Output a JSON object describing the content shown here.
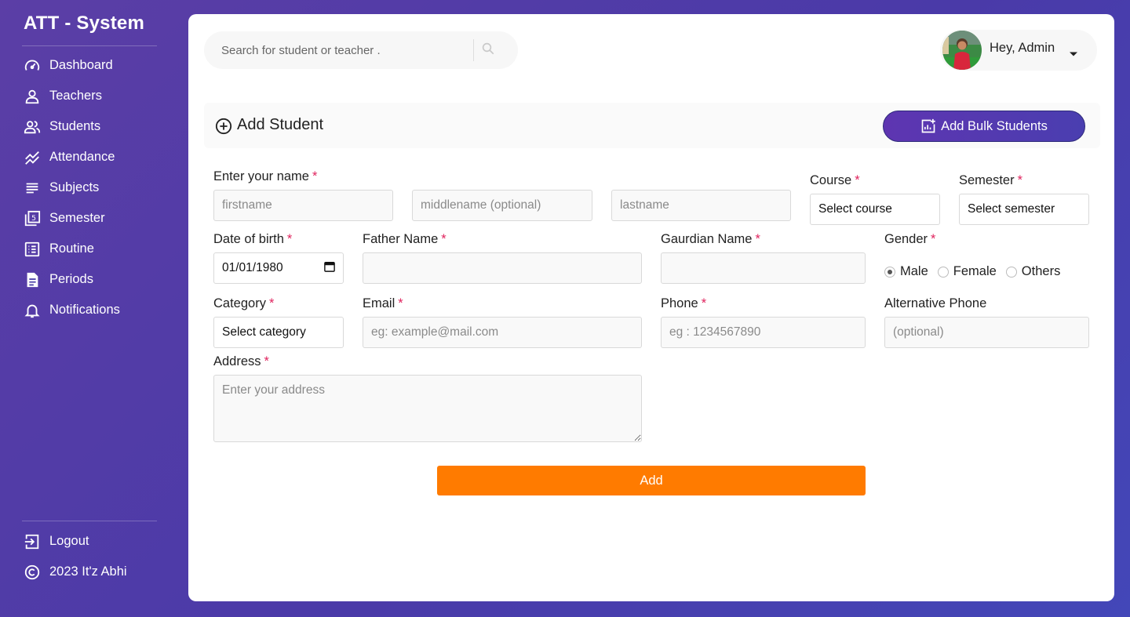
{
  "app": {
    "brand": "ATT - System"
  },
  "sidebar": {
    "items": [
      {
        "label": "Dashboard",
        "icon": "gauge-icon"
      },
      {
        "label": "Teachers",
        "icon": "person-icon"
      },
      {
        "label": "Students",
        "icon": "people-icon"
      },
      {
        "label": "Attendance",
        "icon": "trend-chart-icon"
      },
      {
        "label": "Subjects",
        "icon": "list-lines-icon"
      },
      {
        "label": "Semester",
        "icon": "numbered-stack-icon"
      },
      {
        "label": "Routine",
        "icon": "checklist-icon"
      },
      {
        "label": "Periods",
        "icon": "document-icon"
      },
      {
        "label": "Notifications",
        "icon": "bell-icon"
      }
    ],
    "bottom": [
      {
        "label": "Logout",
        "icon": "logout-icon"
      },
      {
        "label": "2023 It'z Abhi",
        "icon": "copyright-icon"
      }
    ]
  },
  "header": {
    "search_placeholder": "Search for student or teacher .",
    "greeting": "Hey, Admin"
  },
  "page": {
    "title": "Add Student",
    "bulk_button": "Add Bulk Students"
  },
  "form": {
    "name_label": "Enter your name",
    "firstname_placeholder": "firstname",
    "middlename_placeholder": "middlename (optional)",
    "lastname_placeholder": "lastname",
    "course_label": "Course",
    "course_value": "Select course",
    "semester_label": "Semester",
    "semester_value": "Select semester",
    "dob_label": "Date of birth",
    "dob_value": "01/01/1980",
    "father_label": "Father Name",
    "guardian_label": "Gaurdian Name",
    "gender_label": "Gender",
    "gender_options": [
      "Male",
      "Female",
      "Others"
    ],
    "gender_selected": "Male",
    "category_label": "Category",
    "category_value": "Select category",
    "email_label": "Email",
    "email_placeholder": "eg: example@mail.com",
    "phone_label": "Phone",
    "phone_placeholder": "eg : 1234567890",
    "alt_phone_label": "Alternative Phone",
    "alt_phone_placeholder": "(optional)",
    "address_label": "Address",
    "address_placeholder": "Enter your address",
    "required_mark": "*",
    "submit": "Add"
  },
  "colors": {
    "accent": "#ff7b00",
    "brand_purple": "#5e35b1",
    "required": "#e0245e"
  }
}
